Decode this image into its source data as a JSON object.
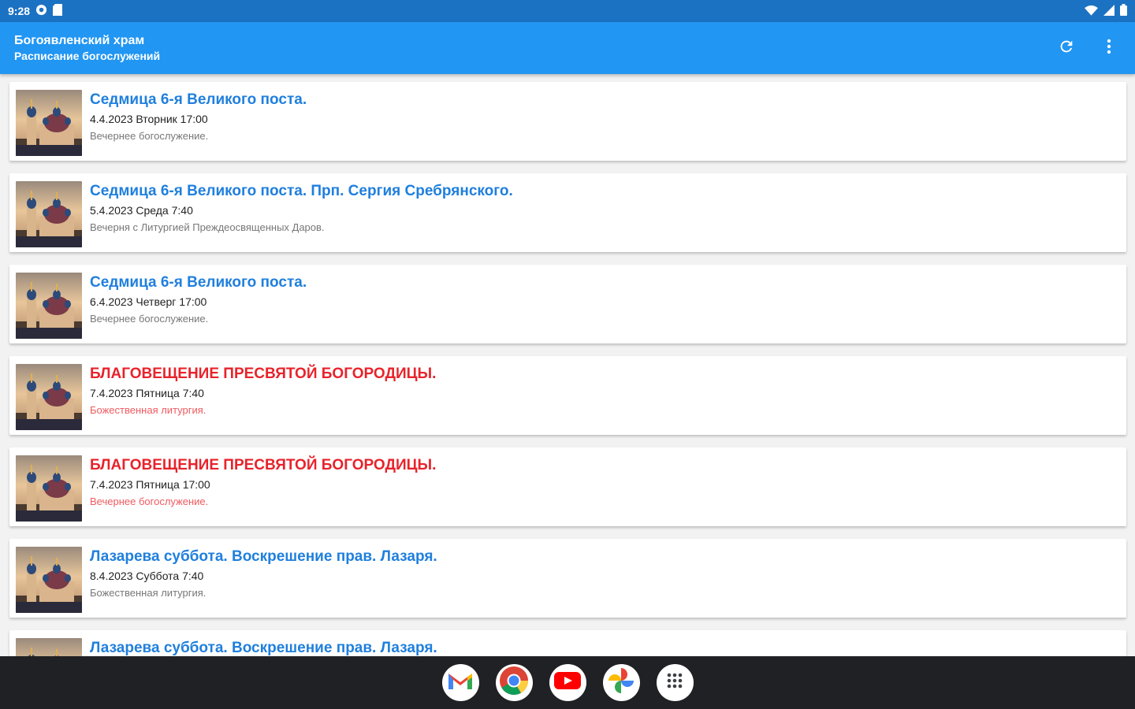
{
  "status_bar": {
    "time": "9:28",
    "left_icons": [
      "settings-icon",
      "sd-card-icon"
    ],
    "right_icons": [
      "wifi-icon",
      "signal-icon",
      "battery-icon"
    ]
  },
  "app_bar": {
    "title": "Богоявленский храм",
    "subtitle": "Расписание богослужений",
    "actions": [
      "refresh-icon",
      "more-vert-icon"
    ],
    "color": "#2196f3"
  },
  "events": [
    {
      "title": "Седмица 6-я Великого поста.",
      "date": "4.4.2023  Вторник 17:00",
      "description": "Вечернее богослужение.",
      "feast": false
    },
    {
      "title": "Седмица 6-я Великого поста. Прп. Сергия Сребрянского.",
      "date": "5.4.2023  Среда 7:40",
      "description": "Вечерня с Литургией Преждеосвященных Даров.",
      "feast": false
    },
    {
      "title": "Седмица 6-я Великого поста.",
      "date": "6.4.2023  Четверг 17:00",
      "description": "Вечернее богослужение.",
      "feast": false
    },
    {
      "title": "БЛАГОВЕЩЕНИЕ ПРЕСВЯТОЙ БОГОРОДИЦЫ.",
      "date": "7.4.2023  Пятница 7:40",
      "description": "Божественная литургия.",
      "feast": true
    },
    {
      "title": "БЛАГОВЕЩЕНИЕ ПРЕСВЯТОЙ БОГОРОДИЦЫ.",
      "date": "7.4.2023  Пятница 17:00",
      "description": "Вечернее богослужение.",
      "feast": true
    },
    {
      "title": "Лазарева суббота. Воскрешение прав. Лазаря.",
      "date": "8.4.2023  Суббота 7:40",
      "description": "Божественная литургия.",
      "feast": false
    },
    {
      "title": "Лазарева суббота. Воскрешение прав. Лазаря.",
      "date": "",
      "description": "",
      "feast": false
    }
  ],
  "colors": {
    "title_normal": "#1f7fdd",
    "title_feast": "#e8232b",
    "description_feast": "#f05a5f"
  },
  "dock": [
    "gmail-icon",
    "chrome-icon",
    "youtube-icon",
    "photos-icon",
    "app-drawer-icon"
  ]
}
